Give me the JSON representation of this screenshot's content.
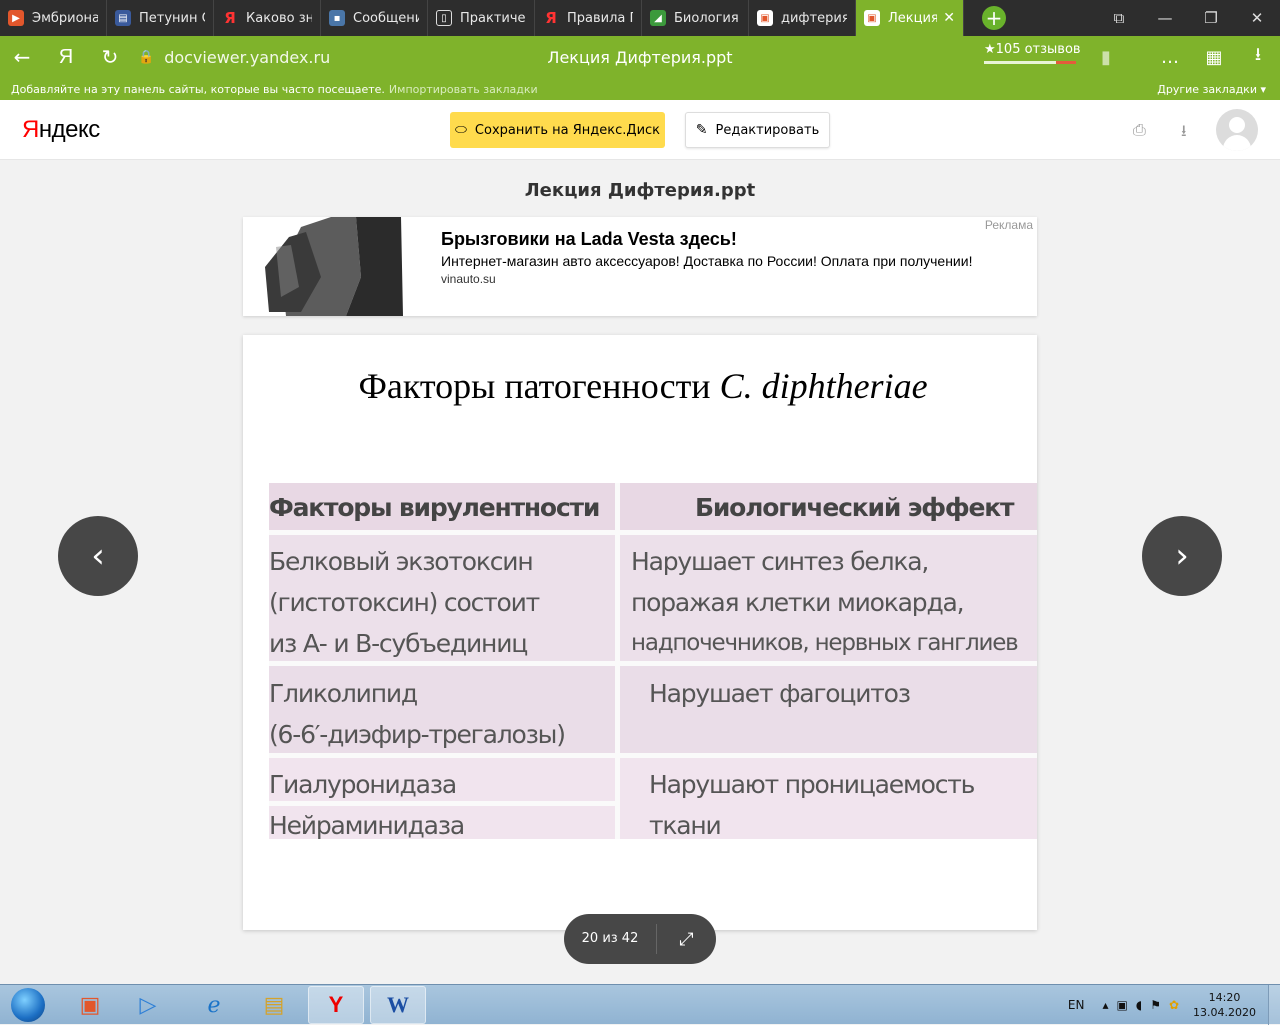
{
  "browser": {
    "tabs": [
      {
        "title": "Эмбриона",
        "icon_color": "#e2572c",
        "icon": "slides-icon"
      },
      {
        "title": "Петунин О",
        "icon_color": "#3a5a9c",
        "icon": "book-icon"
      },
      {
        "title": "Каково зна",
        "icon_color": "#ff0000",
        "icon": "yandex-icon"
      },
      {
        "title": "Сообщени",
        "icon_color": "#4a76a8",
        "icon": "chat-icon"
      },
      {
        "title": "Практичес",
        "icon_color": "#ffffff",
        "icon": "doc-icon"
      },
      {
        "title": "Правила Г",
        "icon_color": "#ff0000",
        "icon": "yandex-icon"
      },
      {
        "title": "Биология /",
        "icon_color": "#3c9a3c",
        "icon": "leaf-icon"
      },
      {
        "title": "дифтерия",
        "icon_color": "#e2572c",
        "icon": "doc-icon"
      },
      {
        "title": "Лекция",
        "icon_color": "#e2572c",
        "icon": "doc-icon",
        "active": true
      }
    ],
    "url": "docviewer.yandex.ru",
    "page_title": "Лекция Дифтерия.ppt",
    "reviews": "★105 отзывов",
    "bookmarks_hint": "Добавляйте на эту панель сайты, которые вы часто посещаете.",
    "import_bookmarks": "Импортировать закладки",
    "other_bookmarks": "Другие закладки ▾",
    "accent_color": "#7fb32b"
  },
  "header": {
    "logo_red": "Я",
    "logo_rest": "ндекс",
    "save_label": "Сохранить на Яндекс.Диск",
    "edit_label": "Редактировать"
  },
  "document": {
    "title": "Лекция Дифтерия.ppt",
    "page_indicator": "20 из 42"
  },
  "ad": {
    "title": "Брызговики на Lada Vesta здесь!",
    "text": "Интернет-магазин авто аксессуаров! Доставка по России! Оплата при получении!",
    "domain": "vinauto.su",
    "label": "Реклама"
  },
  "slide": {
    "title_plain": "Факторы патогенности ",
    "title_italic": "C. diphtheriae",
    "table": {
      "headers": [
        "Факторы вирулентности",
        "Биологический эффект"
      ],
      "rows": [
        {
          "factor": [
            "Белковый экзотоксин",
            "(гистотоксин) состоит",
            "из А- и В-субъединиц"
          ],
          "effect": [
            "Нарушает синтез белка,",
            "поражая клетки миокарда,",
            "надпочечников, нервных ганглиев"
          ]
        },
        {
          "factor": [
            "Гликолипид",
            "(6-6′-диэфир-трегалозы)"
          ],
          "effect": [
            "Нарушает фагоцитоз"
          ]
        },
        {
          "factor": [
            "Гиалуронидаза",
            "Нейраминидаза"
          ],
          "effect": [
            "Нарушают проницаемость",
            "ткани"
          ]
        }
      ]
    }
  },
  "taskbar": {
    "lang": "EN",
    "time": "14:20",
    "date": "13.04.2020"
  }
}
